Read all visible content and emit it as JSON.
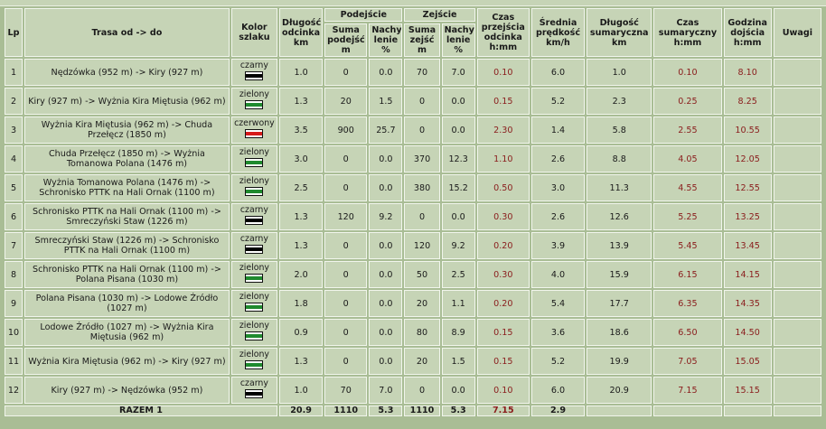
{
  "headers": {
    "lp": "Lp",
    "route": "Trasa od -> do",
    "color": "Kolor szlaku",
    "length": "Długość odcinka km",
    "ascent_group": "Podejście",
    "ascent_sum": "Suma podejść m",
    "ascent_slope": "Nachy lenie %",
    "descent_group": "Zejście",
    "descent_sum": "Suma zejść m",
    "descent_slope": "Nachy lenie %",
    "time": "Czas przejścia odcinka h:mm",
    "speed": "Średnia prędkość km/h",
    "total_length": "Długość sumaryczna km",
    "total_time": "Czas sumaryczny h:mm",
    "arrival": "Godzina dojścia h:mm",
    "notes": "Uwagi"
  },
  "colors": {
    "czarny": "#000000",
    "zielony": "#1f8a2e",
    "czerwony": "#d61a1a"
  },
  "rows": [
    {
      "lp": "1",
      "route": "Nędzówka (952 m) -> Kiry (927 m)",
      "color": "czarny",
      "length": "1.0",
      "asc": "0",
      "asc_slope": "0.0",
      "desc": "70",
      "desc_slope": "7.0",
      "time": "0.10",
      "speed": "6.0",
      "total_len": "1.0",
      "total_time": "0.10",
      "arrival": "8.10",
      "notes": ""
    },
    {
      "lp": "2",
      "route": "Kiry (927 m) -> Wyżnia Kira Miętusia (962 m)",
      "color": "zielony",
      "length": "1.3",
      "asc": "20",
      "asc_slope": "1.5",
      "desc": "0",
      "desc_slope": "0.0",
      "time": "0.15",
      "speed": "5.2",
      "total_len": "2.3",
      "total_time": "0.25",
      "arrival": "8.25",
      "notes": ""
    },
    {
      "lp": "3",
      "route": "Wyżnia Kira Miętusia (962 m) -> Chuda Przełęcz (1850 m)",
      "color": "czerwony",
      "length": "3.5",
      "asc": "900",
      "asc_slope": "25.7",
      "desc": "0",
      "desc_slope": "0.0",
      "time": "2.30",
      "speed": "1.4",
      "total_len": "5.8",
      "total_time": "2.55",
      "arrival": "10.55",
      "notes": ""
    },
    {
      "lp": "4",
      "route": "Chuda Przełęcz (1850 m) -> Wyżnia Tomanowa Polana (1476 m)",
      "color": "zielony",
      "length": "3.0",
      "asc": "0",
      "asc_slope": "0.0",
      "desc": "370",
      "desc_slope": "12.3",
      "time": "1.10",
      "speed": "2.6",
      "total_len": "8.8",
      "total_time": "4.05",
      "arrival": "12.05",
      "notes": ""
    },
    {
      "lp": "5",
      "route": "Wyżnia Tomanowa Polana (1476 m) -> Schronisko PTTK na Hali Ornak (1100 m)",
      "color": "zielony",
      "length": "2.5",
      "asc": "0",
      "asc_slope": "0.0",
      "desc": "380",
      "desc_slope": "15.2",
      "time": "0.50",
      "speed": "3.0",
      "total_len": "11.3",
      "total_time": "4.55",
      "arrival": "12.55",
      "notes": ""
    },
    {
      "lp": "6",
      "route": "Schronisko PTTK na Hali Ornak (1100 m) -> Smreczyński Staw (1226 m)",
      "color": "czarny",
      "length": "1.3",
      "asc": "120",
      "asc_slope": "9.2",
      "desc": "0",
      "desc_slope": "0.0",
      "time": "0.30",
      "speed": "2.6",
      "total_len": "12.6",
      "total_time": "5.25",
      "arrival": "13.25",
      "notes": ""
    },
    {
      "lp": "7",
      "route": "Smreczyński Staw (1226 m) -> Schronisko PTTK na Hali Ornak (1100 m)",
      "color": "czarny",
      "length": "1.3",
      "asc": "0",
      "asc_slope": "0.0",
      "desc": "120",
      "desc_slope": "9.2",
      "time": "0.20",
      "speed": "3.9",
      "total_len": "13.9",
      "total_time": "5.45",
      "arrival": "13.45",
      "notes": ""
    },
    {
      "lp": "8",
      "route": "Schronisko PTTK na Hali Ornak (1100 m) -> Polana Pisana (1030 m)",
      "color": "zielony",
      "length": "2.0",
      "asc": "0",
      "asc_slope": "0.0",
      "desc": "50",
      "desc_slope": "2.5",
      "time": "0.30",
      "speed": "4.0",
      "total_len": "15.9",
      "total_time": "6.15",
      "arrival": "14.15",
      "notes": ""
    },
    {
      "lp": "9",
      "route": "Polana Pisana (1030 m) -> Lodowe Źródło (1027 m)",
      "color": "zielony",
      "length": "1.8",
      "asc": "0",
      "asc_slope": "0.0",
      "desc": "20",
      "desc_slope": "1.1",
      "time": "0.20",
      "speed": "5.4",
      "total_len": "17.7",
      "total_time": "6.35",
      "arrival": "14.35",
      "notes": ""
    },
    {
      "lp": "10",
      "route": "Lodowe Źródło (1027 m) -> Wyżnia Kira Miętusia (962 m)",
      "color": "zielony",
      "length": "0.9",
      "asc": "0",
      "asc_slope": "0.0",
      "desc": "80",
      "desc_slope": "8.9",
      "time": "0.15",
      "speed": "3.6",
      "total_len": "18.6",
      "total_time": "6.50",
      "arrival": "14.50",
      "notes": ""
    },
    {
      "lp": "11",
      "route": "Wyżnia Kira Miętusia (962 m) -> Kiry (927 m)",
      "color": "zielony",
      "length": "1.3",
      "asc": "0",
      "asc_slope": "0.0",
      "desc": "20",
      "desc_slope": "1.5",
      "time": "0.15",
      "speed": "5.2",
      "total_len": "19.9",
      "total_time": "7.05",
      "arrival": "15.05",
      "notes": ""
    },
    {
      "lp": "12",
      "route": "Kiry (927 m) -> Nędzówka (952 m)",
      "color": "czarny",
      "length": "1.0",
      "asc": "70",
      "asc_slope": "7.0",
      "desc": "0",
      "desc_slope": "0.0",
      "time": "0.10",
      "speed": "6.0",
      "total_len": "20.9",
      "total_time": "7.15",
      "arrival": "15.15",
      "notes": ""
    }
  ],
  "total": {
    "label": "RAZEM 1",
    "length": "20.9",
    "asc": "1110",
    "asc_slope": "5.3",
    "desc": "1110",
    "desc_slope": "5.3",
    "time": "7.15",
    "speed": "2.9"
  }
}
